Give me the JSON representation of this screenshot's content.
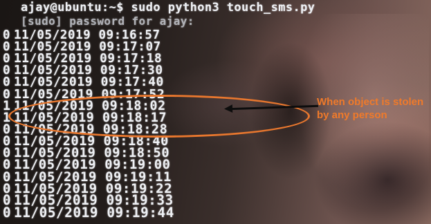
{
  "terminal": {
    "prompt": "ajay@ubuntu:~$",
    "command": "sudo python3 touch_sms.py",
    "sudo_prompt": "[sudo] password for ajay:",
    "rows": [
      {
        "flag": "0",
        "date": "11/05/2019",
        "time": "09:16:57"
      },
      {
        "flag": "0",
        "date": "11/05/2019",
        "time": "09:17:07"
      },
      {
        "flag": "0",
        "date": "11/05/2019",
        "time": "09:17:18"
      },
      {
        "flag": "0",
        "date": "11/05/2019",
        "time": "09:17:30"
      },
      {
        "flag": "0",
        "date": "11/05/2019",
        "time": "09:17:40"
      },
      {
        "flag": "0",
        "date": "11/05/2019",
        "time": "09:17:52"
      },
      {
        "flag": "1",
        "date": "11/05/2019",
        "time": "09:18:02"
      },
      {
        "flag": "1",
        "date": "11/05/2019",
        "time": "09:18:17"
      },
      {
        "flag": "0",
        "date": "11/05/2019",
        "time": "09:18:28"
      },
      {
        "flag": "0",
        "date": "11/05/2019",
        "time": "09:18:40"
      },
      {
        "flag": "0",
        "date": "11/05/2019",
        "time": "09:18:50"
      },
      {
        "flag": "0",
        "date": "11/05/2019",
        "time": "09:19:00"
      },
      {
        "flag": "0",
        "date": "11/05/2019",
        "time": "09:19:11"
      },
      {
        "flag": "0",
        "date": "11/05/2019",
        "time": "09:19:22"
      },
      {
        "flag": "0",
        "date": "11/05/2019",
        "time": "09:19:33"
      },
      {
        "flag": "0",
        "date": "11/05/2019",
        "time": "09:19:44"
      }
    ]
  },
  "annotation": {
    "text": "When object is stolen by any person",
    "color": "#f07a2a"
  }
}
